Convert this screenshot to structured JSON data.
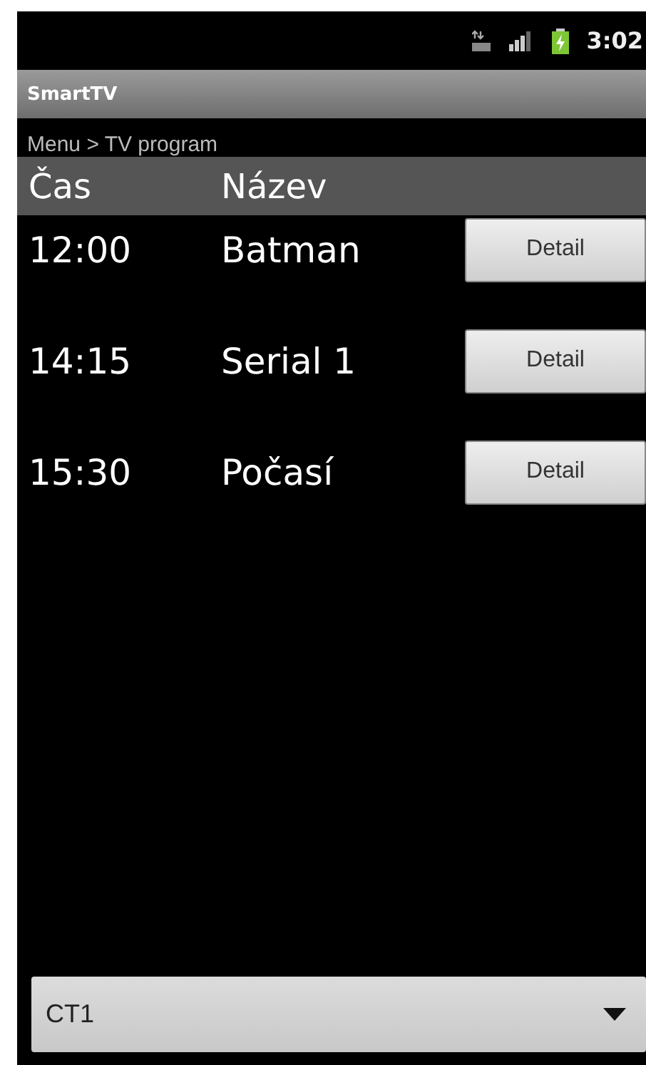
{
  "status_bar": {
    "time": "3:02"
  },
  "app_title": "SmartTV",
  "breadcrumb": "Menu > TV program",
  "table": {
    "columns": [
      "Čas",
      "Název"
    ],
    "rows": [
      {
        "time": "12:00",
        "name": "Batman",
        "button": "Detail"
      },
      {
        "time": "14:15",
        "name": "Serial 1",
        "button": "Detail"
      },
      {
        "time": "15:30",
        "name": "Počasí",
        "button": "Detail"
      }
    ]
  },
  "channel_spinner": {
    "value": "CT1"
  }
}
